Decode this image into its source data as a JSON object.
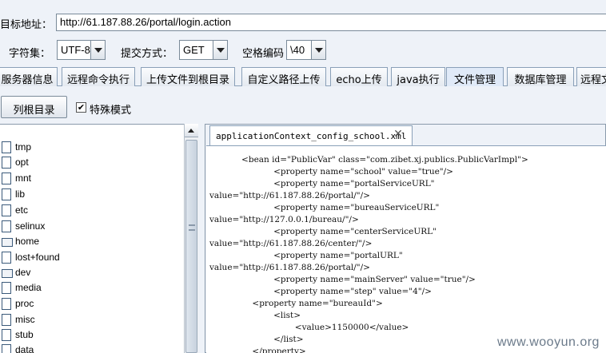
{
  "toolbar": {
    "url_label": "目标地址：",
    "url_value": "http://61.187.88.26/portal/login.action",
    "charset_label": "字符集：",
    "charset_value": "UTF-8",
    "method_label": "提交方式：",
    "method_value": "GET",
    "space_label": "空格编码",
    "space_value": "\\40"
  },
  "tabs": [
    {
      "label": "服务器信息"
    },
    {
      "label": "远程命令执行"
    },
    {
      "label": "上传文件到根目录"
    },
    {
      "label": "自定义路径上传"
    },
    {
      "label": "echo上传"
    },
    {
      "label": "java执行"
    },
    {
      "label": "文件管理",
      "active": true
    },
    {
      "label": "数据库管理"
    },
    {
      "label": "远程文"
    }
  ],
  "file_manager": {
    "list_root_button": "列根目录",
    "special_mode_checked": true,
    "special_mode_label": "特殊模式",
    "tree": [
      {
        "name": "tmp",
        "type": "file"
      },
      {
        "name": "opt",
        "type": "file"
      },
      {
        "name": "mnt",
        "type": "file"
      },
      {
        "name": "lib",
        "type": "file"
      },
      {
        "name": "etc",
        "type": "file"
      },
      {
        "name": "selinux",
        "type": "file"
      },
      {
        "name": "home",
        "type": "folder"
      },
      {
        "name": "lost+found",
        "type": "file"
      },
      {
        "name": "dev",
        "type": "folder"
      },
      {
        "name": "media",
        "type": "file"
      },
      {
        "name": "proc",
        "type": "file"
      },
      {
        "name": "misc",
        "type": "file"
      },
      {
        "name": "stub",
        "type": "file"
      },
      {
        "name": "data",
        "type": "file"
      }
    ]
  },
  "editor": {
    "tab_title": "applicationContext_config_school.xml",
    "lines": [
      "            <bean id=\"PublicVar\" class=\"com.zibet.xj.publics.PublicVarImpl\">",
      "                        <property name=\"school\" value=\"true\"/>",
      "                        <property name=\"portalServiceURL\"",
      "value=\"http://61.187.88.26/portal/\"/>",
      "                        <property name=\"bureauServiceURL\"",
      "value=\"http://127.0.0.1/bureau/\"/>",
      "                        <property name=\"centerServiceURL\"",
      "value=\"http://61.187.88.26/center/\"/>",
      "                        <property name=\"portalURL\"",
      "value=\"http://61.187.88.26/portal/\"/>",
      "                        <property name=\"mainServer\" value=\"true\"/>",
      "                        <property name=\"step\" value=\"4\"/>",
      "                <property name=\"bureauId\">",
      "                        <list>",
      "                                <value>1150000</value>",
      "                        </list>",
      "                </property>"
    ]
  },
  "watermark": "www.wooyun.org"
}
